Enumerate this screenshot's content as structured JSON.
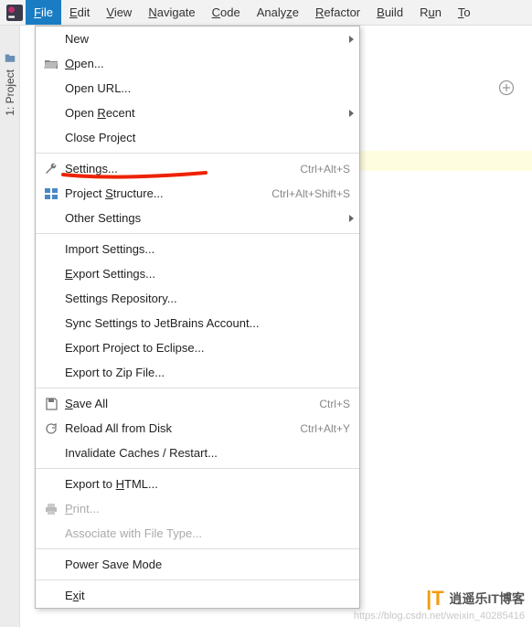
{
  "menubar": {
    "items": [
      {
        "label": "File",
        "u": "F",
        "rest": "ile",
        "active": true
      },
      {
        "label": "Edit",
        "u": "E",
        "rest": "dit"
      },
      {
        "label": "View",
        "u": "V",
        "rest": "iew"
      },
      {
        "label": "Navigate",
        "u": "N",
        "rest": "avigate"
      },
      {
        "label": "Code",
        "u": "C",
        "rest": "ode"
      },
      {
        "label": "Analyze",
        "u": "",
        "rest": "Analy",
        "u2": "z",
        "rest2": "e"
      },
      {
        "label": "Refactor",
        "u": "R",
        "rest": "efactor"
      },
      {
        "label": "Build",
        "u": "B",
        "rest": "uild"
      },
      {
        "label": "Run",
        "u": "",
        "rest": "R",
        "u2": "u",
        "rest2": "n"
      },
      {
        "label": "Tools",
        "u": "T",
        "rest": "o"
      }
    ]
  },
  "sidebar": {
    "project_label": "1: Project"
  },
  "file_menu": {
    "new": "New",
    "open": "Open...",
    "open_url": "Open URL...",
    "open_recent": "Open Recent",
    "close_project": "Close Project",
    "settings": "Settings...",
    "settings_sc": "Ctrl+Alt+S",
    "proj_structure": "Project Structure...",
    "proj_structure_sc": "Ctrl+Alt+Shift+S",
    "other_settings": "Other Settings",
    "import_settings": "Import Settings...",
    "export_settings": "Export Settings...",
    "settings_repo": "Settings Repository...",
    "sync_settings": "Sync Settings to JetBrains Account...",
    "export_eclipse": "Export Project to Eclipse...",
    "export_zip": "Export to Zip File...",
    "save_all": "Save All",
    "save_all_sc": "Ctrl+S",
    "reload_disk": "Reload All from Disk",
    "reload_disk_sc": "Ctrl+Alt+Y",
    "invalidate": "Invalidate Caches / Restart...",
    "export_html": "Export to HTML...",
    "print": "Print...",
    "assoc_ft": "Associate with File Type...",
    "power_save": "Power Save Mode",
    "exit": "Exit",
    "u_open": "O",
    "r_open": "pen...",
    "u_recent": "R",
    "r_recent_pre": "Open ",
    "r_recent": "ecent",
    "u_settings": "S",
    "r_settings": "ettings...",
    "u_structure": "S",
    "r_struct_pre": "Project ",
    "r_structure": "tructure...",
    "u_exp": "E",
    "r_exp": "xport Settings...",
    "u_save": "S",
    "r_save": "ave All",
    "u_html": "H",
    "r_html_pre": "Export to ",
    "r_html": "TML...",
    "u_print": "P",
    "r_print": "rint...",
    "u_exit": "x",
    "r_exit_pre": "E",
    "r_exit": "it"
  },
  "watermark": {
    "brand": "逍遥乐IT博客",
    "url": "https://blog.csdn.net/weixin_40285416"
  }
}
